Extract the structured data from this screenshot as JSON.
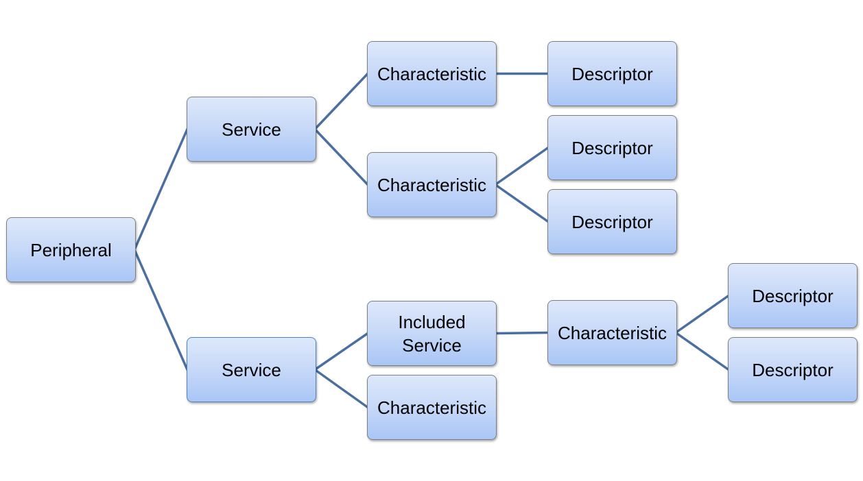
{
  "diagram": {
    "title": "",
    "line_color": "#4a6fa0",
    "node_fill_top": "#dde8fb",
    "node_fill_bottom": "#a9c6f6",
    "nodes": [
      {
        "id": "peripheral",
        "label": "Peripheral",
        "level": 0
      },
      {
        "id": "service-1",
        "label": "Service",
        "level": 1
      },
      {
        "id": "service-2",
        "label": "Service",
        "level": 1
      },
      {
        "id": "characteristic-1",
        "label": "Characteristic",
        "level": 2
      },
      {
        "id": "characteristic-2",
        "label": "Characteristic",
        "level": 2
      },
      {
        "id": "included-service",
        "label": "Included\nService",
        "level": 2
      },
      {
        "id": "characteristic-3",
        "label": "Characteristic",
        "level": 2
      },
      {
        "id": "descriptor-1",
        "label": "Descriptor",
        "level": 3
      },
      {
        "id": "descriptor-2",
        "label": "Descriptor",
        "level": 3
      },
      {
        "id": "descriptor-3",
        "label": "Descriptor",
        "level": 3
      },
      {
        "id": "characteristic-4",
        "label": "Characteristic",
        "level": 3
      },
      {
        "id": "descriptor-4",
        "label": "Descriptor",
        "level": 4
      },
      {
        "id": "descriptor-5",
        "label": "Descriptor",
        "level": 4
      }
    ],
    "edges": [
      [
        "peripheral",
        "service-1"
      ],
      [
        "peripheral",
        "service-2"
      ],
      [
        "service-1",
        "characteristic-1"
      ],
      [
        "service-1",
        "characteristic-2"
      ],
      [
        "characteristic-1",
        "descriptor-1"
      ],
      [
        "characteristic-2",
        "descriptor-2"
      ],
      [
        "characteristic-2",
        "descriptor-3"
      ],
      [
        "service-2",
        "included-service"
      ],
      [
        "service-2",
        "characteristic-3"
      ],
      [
        "included-service",
        "characteristic-4"
      ],
      [
        "characteristic-4",
        "descriptor-4"
      ],
      [
        "characteristic-4",
        "descriptor-5"
      ]
    ]
  }
}
